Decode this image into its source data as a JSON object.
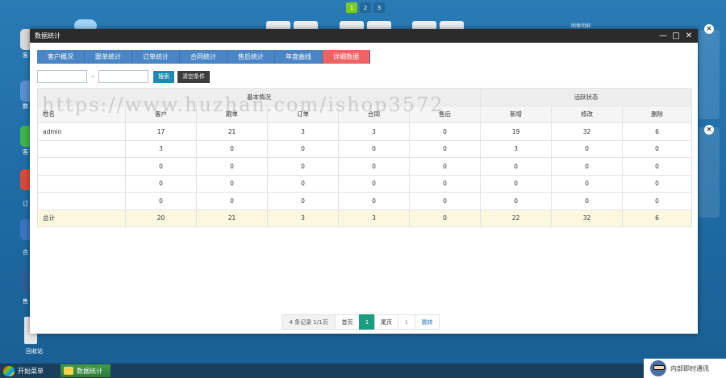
{
  "desktop": {
    "pages": [
      "1",
      "2",
      "3"
    ],
    "icon_labels": [
      "客",
      "数",
      "客",
      "订",
      "合",
      "售"
    ],
    "recycle_bin": "回收站",
    "side_panel_title": "图像明细"
  },
  "taskbar": {
    "start_label": "开始菜单",
    "task_label": "数据统计",
    "im_label": "内部即时通讯"
  },
  "window": {
    "title": "数据统计",
    "controls": {
      "minimize": "—",
      "maximize": "□",
      "close": "✕"
    },
    "tabs": [
      {
        "label": "客户概况"
      },
      {
        "label": "跟单统计"
      },
      {
        "label": "订单统计"
      },
      {
        "label": "合同统计"
      },
      {
        "label": "售后统计"
      },
      {
        "label": "年度曲线"
      },
      {
        "label": "详细数据"
      }
    ],
    "active_tab": 6,
    "filters": {
      "range_sep": "-",
      "search_btn": "搜索",
      "clear_btn": "清空条件"
    },
    "table": {
      "group_headers": {
        "basic": "基本情况",
        "activity": "活跃状态"
      },
      "columns": [
        "姓名",
        "客户",
        "跟单",
        "订单",
        "合同",
        "售后",
        "新增",
        "修改",
        "删除"
      ],
      "rows": [
        [
          "admin",
          "17",
          "21",
          "3",
          "3",
          "0",
          "19",
          "32",
          "6"
        ],
        [
          "",
          "3",
          "0",
          "0",
          "0",
          "0",
          "3",
          "0",
          "0"
        ],
        [
          "",
          "0",
          "0",
          "0",
          "0",
          "0",
          "0",
          "0",
          "0"
        ],
        [
          "",
          "0",
          "0",
          "0",
          "0",
          "0",
          "0",
          "0",
          "0"
        ],
        [
          "",
          "0",
          "0",
          "0",
          "0",
          "0",
          "0",
          "0",
          "0"
        ]
      ],
      "total": [
        "总计",
        "20",
        "21",
        "3",
        "3",
        "0",
        "22",
        "32",
        "6"
      ]
    },
    "pagination": {
      "count_text": "4 条记录 1/1页",
      "first": "首页",
      "current": "1",
      "last": "尾页",
      "input_value": "1",
      "go": "跳转"
    }
  },
  "watermark": "https://www.huzhan.com/ishop3572",
  "colors": {
    "tab_bg": "#4a86c5",
    "tab_active": "#ee6464",
    "search_btn": "#1d8bb0",
    "total_row": "#fbf8df",
    "page_current": "#1b9e7f"
  }
}
